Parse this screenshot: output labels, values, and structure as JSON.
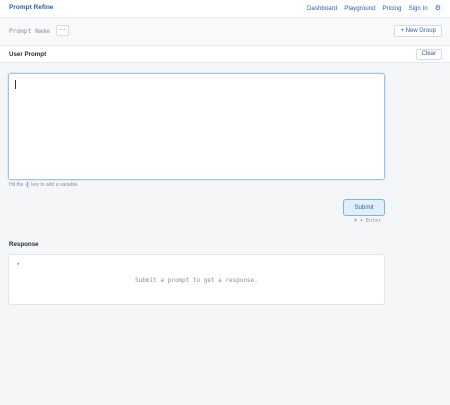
{
  "nav": {
    "brand": "Prompt Refine",
    "links": [
      "Dashboard",
      "Playground",
      "Pricing",
      "Sign In"
    ],
    "settings_icon": "gear-icon"
  },
  "prompt_bar": {
    "name_placeholder": "Prompt Name",
    "more_label": "···",
    "new_group_label": "+ New Group"
  },
  "user_prompt": {
    "title": "User Prompt",
    "clear_label": "Clear",
    "value": "",
    "hint_before": "Hit the",
    "hint_key": "{",
    "hint_after": "key to add a variable."
  },
  "submit": {
    "label": "Submit",
    "shortcut": "⌘ + Enter"
  },
  "response": {
    "title": "Response",
    "icon": "*",
    "empty_text": "Submit a prompt to get a response."
  },
  "colors": {
    "accent": "#2b5fb8",
    "focus_border": "#9ec4ea",
    "submit_bg": "#e3eefb"
  }
}
